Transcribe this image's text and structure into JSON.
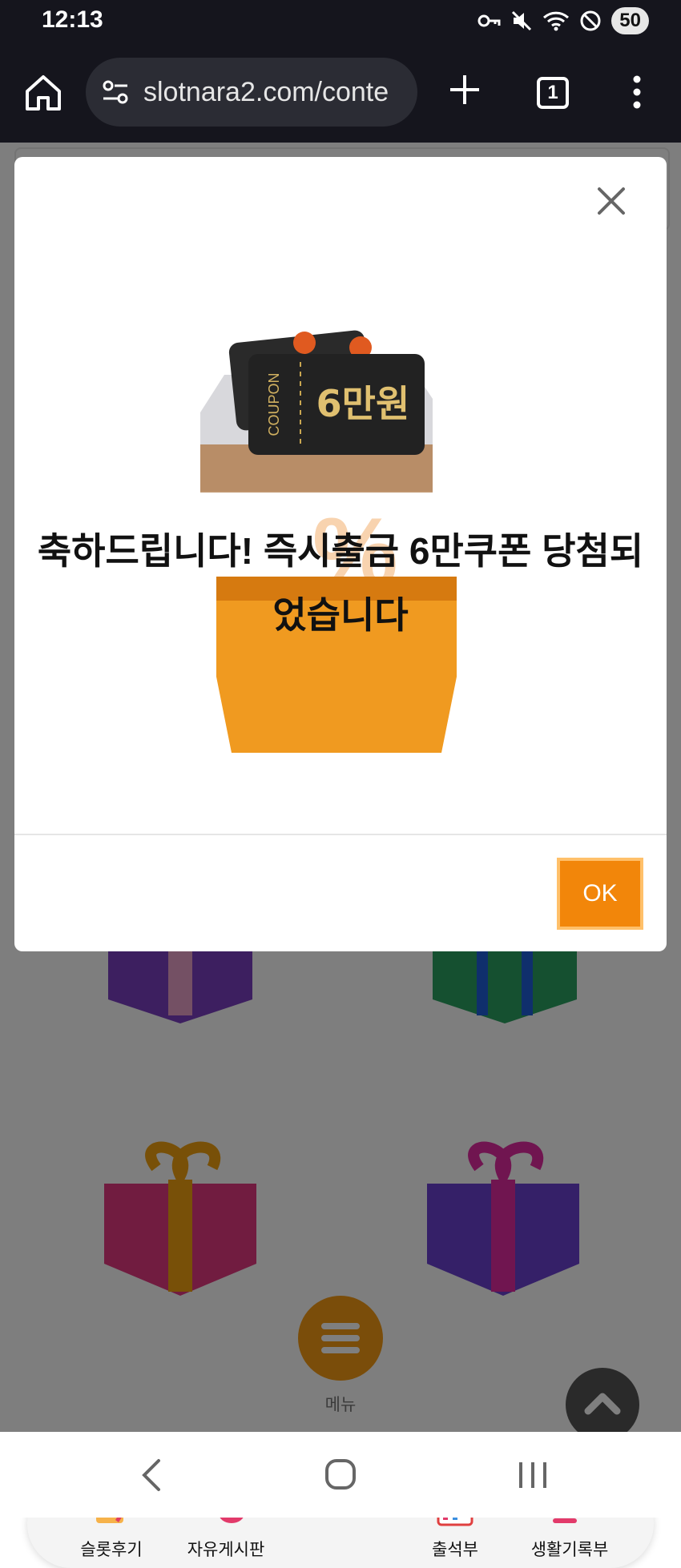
{
  "status_bar": {
    "time": "12:13",
    "battery": "50"
  },
  "browser": {
    "url": "slotnara2.com/conte",
    "tab_count": "1"
  },
  "modal": {
    "coupon_brand": "COUPON",
    "coupon_amount": "6만원",
    "message": "축하드립니다! 즉시출금 6만쿠폰 당첨되었습니다",
    "ok_label": "OK"
  },
  "bottom_nav": {
    "items": [
      {
        "label": "슬롯후기",
        "icon": "review-icon"
      },
      {
        "label": "자유게시판",
        "icon": "chat-bubbles-icon"
      },
      {
        "label": "메뉴",
        "icon": "hamburger-menu-icon"
      },
      {
        "label": "출석부",
        "icon": "calendar-icon"
      },
      {
        "label": "생활기록부",
        "icon": "emoji-record-icon"
      }
    ]
  },
  "colors": {
    "accent": "#f2860a",
    "menu_fab": "#f59a14",
    "status_bg": "#15151d"
  }
}
